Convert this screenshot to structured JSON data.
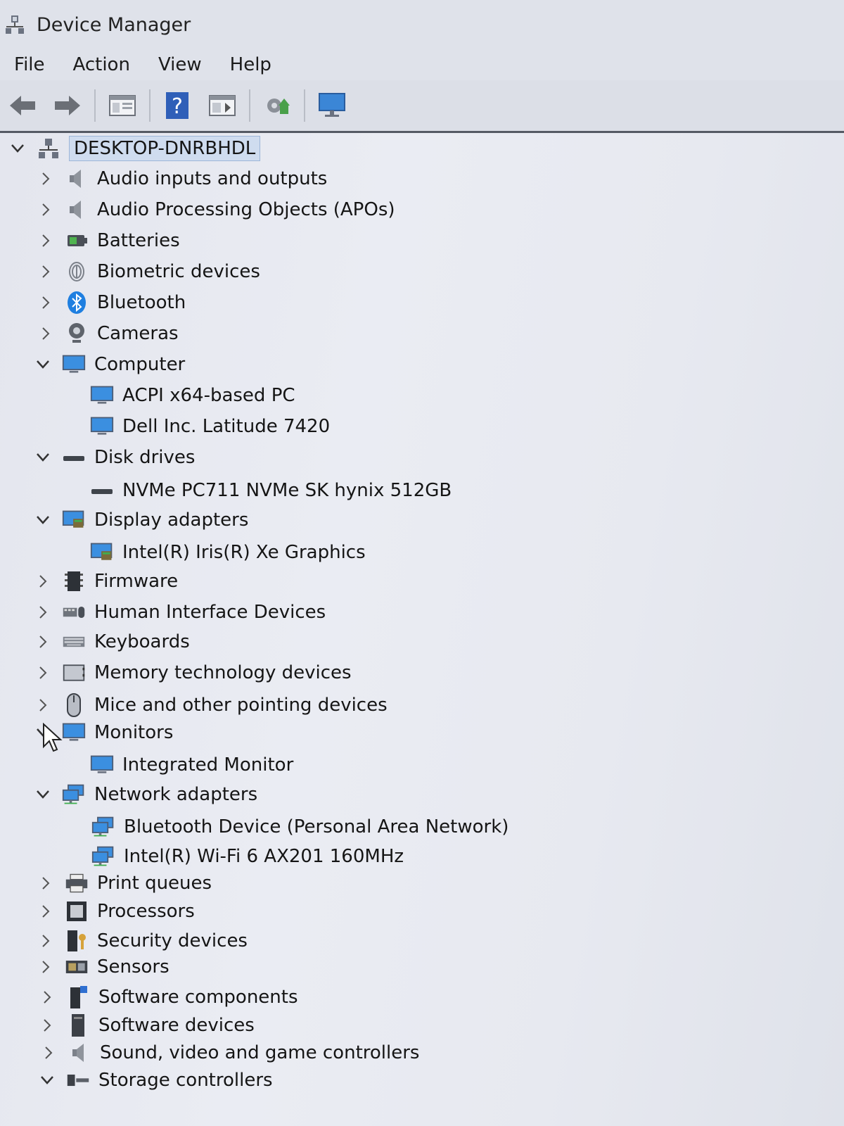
{
  "window": {
    "title": "Device Manager"
  },
  "menu": [
    "File",
    "Action",
    "View",
    "Help"
  ],
  "toolbar": {
    "buttons": [
      "back-icon",
      "forward-icon",
      "properties-icon",
      "help-icon",
      "show-hidden-icon",
      "scan-hardware-icon",
      "monitor-icon"
    ]
  },
  "tree": {
    "root": "DESKTOP-DNRBHDL",
    "items": [
      {
        "label": "Audio inputs and outputs",
        "level": 1,
        "expanded": false,
        "icon": "speaker-icon"
      },
      {
        "label": "Audio Processing Objects (APOs)",
        "level": 1,
        "expanded": false,
        "icon": "speaker-icon"
      },
      {
        "label": "Batteries",
        "level": 1,
        "expanded": false,
        "icon": "battery-icon"
      },
      {
        "label": "Biometric devices",
        "level": 1,
        "expanded": false,
        "icon": "fingerprint-icon"
      },
      {
        "label": "Bluetooth",
        "level": 1,
        "expanded": false,
        "icon": "bluetooth-icon"
      },
      {
        "label": "Cameras",
        "level": 1,
        "expanded": false,
        "icon": "camera-icon"
      },
      {
        "label": "Computer",
        "level": 1,
        "expanded": true,
        "icon": "computer-icon"
      },
      {
        "label": "ACPI x64-based PC",
        "level": 2,
        "icon": "computer-icon"
      },
      {
        "label": "Dell Inc. Latitude 7420",
        "level": 2,
        "icon": "computer-icon"
      },
      {
        "label": "Disk drives",
        "level": 1,
        "expanded": true,
        "icon": "disk-icon"
      },
      {
        "label": "NVMe PC711 NVMe SK hynix 512GB",
        "level": 2,
        "icon": "disk-icon"
      },
      {
        "label": "Display adapters",
        "level": 1,
        "expanded": true,
        "icon": "display-adapter-icon"
      },
      {
        "label": "Intel(R) Iris(R) Xe Graphics",
        "level": 2,
        "icon": "display-adapter-icon"
      },
      {
        "label": "Firmware",
        "level": 1,
        "expanded": false,
        "icon": "firmware-icon"
      },
      {
        "label": "Human Interface Devices",
        "level": 1,
        "expanded": false,
        "icon": "hid-icon"
      },
      {
        "label": "Keyboards",
        "level": 1,
        "expanded": false,
        "icon": "keyboard-icon"
      },
      {
        "label": "Memory technology devices",
        "level": 1,
        "expanded": false,
        "icon": "memory-icon"
      },
      {
        "label": "Mice and other pointing devices",
        "level": 1,
        "expanded": false,
        "icon": "mouse-icon"
      },
      {
        "label": "Monitors",
        "level": 1,
        "expanded": true,
        "icon": "monitor-icon"
      },
      {
        "label": "Integrated Monitor",
        "level": 2,
        "icon": "monitor-icon"
      },
      {
        "label": "Network adapters",
        "level": 1,
        "expanded": true,
        "icon": "network-icon"
      },
      {
        "label": "Bluetooth Device (Personal Area Network)",
        "level": 2,
        "icon": "network-icon"
      },
      {
        "label": "Intel(R) Wi-Fi 6 AX201 160MHz",
        "level": 2,
        "icon": "network-icon"
      },
      {
        "label": "Print queues",
        "level": 1,
        "expanded": false,
        "icon": "printer-icon"
      },
      {
        "label": "Processors",
        "level": 1,
        "expanded": false,
        "icon": "processor-icon"
      },
      {
        "label": "Security devices",
        "level": 1,
        "expanded": false,
        "icon": "security-icon"
      },
      {
        "label": "Sensors",
        "level": 1,
        "expanded": false,
        "icon": "sensor-icon"
      },
      {
        "label": "Software components",
        "level": 1,
        "expanded": false,
        "icon": "software-component-icon"
      },
      {
        "label": "Software devices",
        "level": 1,
        "expanded": false,
        "icon": "software-device-icon"
      },
      {
        "label": "Sound, video and game controllers",
        "level": 1,
        "expanded": false,
        "icon": "speaker-icon"
      },
      {
        "label": "Storage controllers",
        "level": 1,
        "expanded": true,
        "icon": "storage-icon"
      }
    ]
  }
}
